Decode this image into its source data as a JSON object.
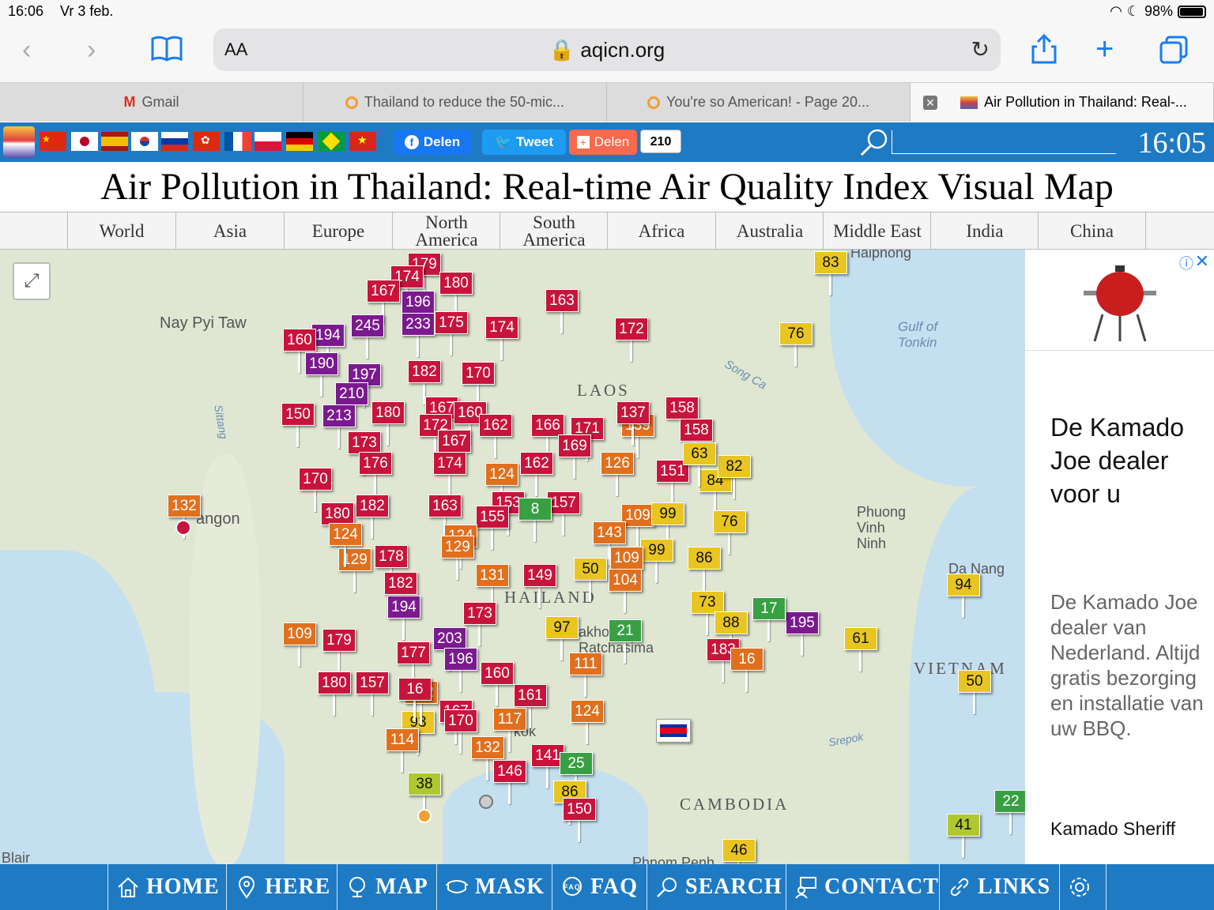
{
  "status": {
    "time": "16:06",
    "date": "Vr 3 feb.",
    "battery": "98%"
  },
  "toolbar": {
    "aa": "AA",
    "url": "aqicn.org"
  },
  "tabs": [
    {
      "label": "Gmail"
    },
    {
      "label": "Thailand to reduce the 50-mic..."
    },
    {
      "label": "You're so American! - Page 20..."
    },
    {
      "label": "Air Pollution in Thailand: Real-..."
    }
  ],
  "share": {
    "facebook": "Delen",
    "twitter": "Tweet",
    "addthis": "Delen",
    "count": "210"
  },
  "clock": "16:05",
  "title": "Air Pollution in Thailand: Real-time Air Quality Index Visual Map",
  "regions": [
    "World",
    "Asia",
    "Europe",
    "North America",
    "South America",
    "Africa",
    "Australia",
    "Middle East",
    "India",
    "China"
  ],
  "map_labels": {
    "naypyitaw": "Nay Pyi Taw",
    "rangoon": "angon",
    "laos": "LAOS",
    "thailand": "HAILAND",
    "cambodia": "CAMBODIA",
    "vietnam": "VIETNAM",
    "gulf": "Gulf of Tonkin",
    "phuong": "Phuong Vinh Ninh",
    "danang": "Da Nang",
    "haiphong": "Haiphong",
    "blair": "Blair",
    "phnom": "Phnom Penh",
    "songca": "Song Ca",
    "sittang": "Sittang",
    "srepok": "Srepok",
    "nakhon": "akhon Ratchasima",
    "bangkok": "kok"
  },
  "markers": [
    {
      "v": "179",
      "c": "#c8143c"
    },
    {
      "v": "174",
      "c": "#c8143c"
    },
    {
      "v": "180",
      "c": "#c8143c"
    },
    {
      "v": "167",
      "c": "#c8143c"
    },
    {
      "v": "196",
      "c": "#7b1a8f"
    },
    {
      "v": "163",
      "c": "#c8143c"
    },
    {
      "v": "245",
      "c": "#7b1a8f"
    },
    {
      "v": "233",
      "c": "#7b1a8f"
    },
    {
      "v": "175",
      "c": "#c8143c"
    },
    {
      "v": "174",
      "c": "#c8143c"
    },
    {
      "v": "172",
      "c": "#c8143c"
    },
    {
      "v": "194",
      "c": "#7b1a8f"
    },
    {
      "v": "160",
      "c": "#c8143c"
    },
    {
      "v": "190",
      "c": "#7b1a8f"
    },
    {
      "v": "197",
      "c": "#7b1a8f"
    },
    {
      "v": "182",
      "c": "#c8143c"
    },
    {
      "v": "170",
      "c": "#c8143c"
    },
    {
      "v": "210",
      "c": "#7b1a8f"
    },
    {
      "v": "180",
      "c": "#c8143c"
    },
    {
      "v": "213",
      "c": "#7b1a8f"
    },
    {
      "v": "167",
      "c": "#c8143c"
    },
    {
      "v": "160",
      "c": "#c8143c"
    },
    {
      "v": "172",
      "c": "#c8143c"
    },
    {
      "v": "162",
      "c": "#c8143c"
    },
    {
      "v": "166",
      "c": "#c8143c"
    },
    {
      "v": "171",
      "c": "#c8143c"
    },
    {
      "v": "158",
      "c": "#c8143c"
    },
    {
      "v": "139",
      "c": "#e0701e"
    },
    {
      "v": "158",
      "c": "#c8143c"
    },
    {
      "v": "173",
      "c": "#c8143c"
    },
    {
      "v": "167",
      "c": "#c8143c"
    },
    {
      "v": "169",
      "c": "#c8143c"
    },
    {
      "v": "176",
      "c": "#c8143c"
    },
    {
      "v": "174",
      "c": "#c8143c"
    },
    {
      "v": "124",
      "c": "#e0701e"
    },
    {
      "v": "162",
      "c": "#c8143c"
    },
    {
      "v": "126",
      "c": "#e0701e"
    },
    {
      "v": "151",
      "c": "#c8143c"
    },
    {
      "v": "84",
      "c": "#e8c520"
    },
    {
      "v": "82",
      "c": "#e8c520"
    },
    {
      "v": "170",
      "c": "#c8143c"
    },
    {
      "v": "132",
      "c": "#e0701e"
    },
    {
      "v": "182",
      "c": "#c8143c"
    },
    {
      "v": "163",
      "c": "#c8143c"
    },
    {
      "v": "153",
      "c": "#c8143c"
    },
    {
      "v": "157",
      "c": "#c8143c"
    },
    {
      "v": "8",
      "c": "#38a043"
    },
    {
      "v": "180",
      "c": "#c8143c"
    },
    {
      "v": "155",
      "c": "#c8143c"
    },
    {
      "v": "109",
      "c": "#e0701e"
    },
    {
      "v": "99",
      "c": "#e8c520"
    },
    {
      "v": "76",
      "c": "#e8c520"
    },
    {
      "v": "124",
      "c": "#e0701e"
    },
    {
      "v": "143",
      "c": "#e0701e"
    },
    {
      "v": "129",
      "c": "#e0701e"
    },
    {
      "v": "178",
      "c": "#c8143c"
    },
    {
      "v": "99",
      "c": "#e8c520"
    },
    {
      "v": "109",
      "c": "#e0701e"
    },
    {
      "v": "86",
      "c": "#e8c520"
    },
    {
      "v": "129",
      "c": "#e0701e"
    },
    {
      "v": "131",
      "c": "#e0701e"
    },
    {
      "v": "149",
      "c": "#c8143c"
    },
    {
      "v": "50",
      "c": "#e8c520"
    },
    {
      "v": "104",
      "c": "#e0701e"
    },
    {
      "v": "182",
      "c": "#c8143c"
    },
    {
      "v": "194",
      "c": "#7b1a8f"
    },
    {
      "v": "173",
      "c": "#c8143c"
    },
    {
      "v": "179",
      "c": "#c8143c"
    },
    {
      "v": "203",
      "c": "#7b1a8f"
    },
    {
      "v": "97",
      "c": "#e8c520"
    },
    {
      "v": "21",
      "c": "#38a043"
    },
    {
      "v": "73",
      "c": "#e8c520"
    },
    {
      "v": "88",
      "c": "#e8c520"
    },
    {
      "v": "195",
      "c": "#7b1a8f"
    },
    {
      "v": "177",
      "c": "#c8143c"
    },
    {
      "v": "196",
      "c": "#7b1a8f"
    },
    {
      "v": "111",
      "c": "#e0701e"
    },
    {
      "v": "183",
      "c": "#c8143c"
    },
    {
      "v": "160",
      "c": "#c8143c"
    },
    {
      "v": "157",
      "c": "#c8143c"
    },
    {
      "v": "161",
      "c": "#c8143c"
    },
    {
      "v": "167",
      "c": "#c8143c"
    },
    {
      "v": "117",
      "c": "#e0701e"
    },
    {
      "v": "124",
      "c": "#e0701e"
    },
    {
      "v": "93",
      "c": "#e8c520"
    },
    {
      "v": "114",
      "c": "#e0701e"
    },
    {
      "v": "132",
      "c": "#e0701e"
    },
    {
      "v": "141",
      "c": "#c8143c"
    },
    {
      "v": "25",
      "c": "#38a043"
    },
    {
      "v": "146",
      "c": "#c8143c"
    },
    {
      "v": "38",
      "c": "#b0c830"
    },
    {
      "v": "86",
      "c": "#e8c520"
    },
    {
      "v": "150",
      "c": "#c8143c"
    },
    {
      "v": "76",
      "c": "#e8c520"
    },
    {
      "v": "83",
      "c": "#e8c520"
    },
    {
      "v": "94",
      "c": "#e8c520"
    },
    {
      "v": "61",
      "c": "#e8c520"
    },
    {
      "v": "50",
      "c": "#e8c520"
    },
    {
      "v": "22",
      "c": "#38a043"
    },
    {
      "v": "41",
      "c": "#b0c830"
    },
    {
      "v": "46",
      "c": "#e8c520"
    },
    {
      "v": "132",
      "c": "#e0701e"
    },
    {
      "v": "180",
      "c": "#c8143c"
    },
    {
      "v": "124",
      "c": "#e0701e"
    },
    {
      "v": "16",
      "c": "#c8143c"
    },
    {
      "v": "109",
      "c": "#e0701e"
    },
    {
      "v": "150",
      "c": "#c8143c"
    },
    {
      "v": "170",
      "c": "#c8143c"
    },
    {
      "v": "17",
      "c": "#38a043"
    },
    {
      "v": "63",
      "c": "#e8c520"
    },
    {
      "v": "16",
      "c": "#e0701e"
    },
    {
      "v": "137",
      "c": "#c8143c"
    }
  ],
  "ad": {
    "headline": "De Kamado Joe dealer voor u",
    "body": "De Kamado Joe dealer van Nederland. Altijd gratis bezorging en installatie van uw BBQ.",
    "brand": "Kamado Sheriff"
  },
  "bottomnav": [
    "HOME",
    "HERE",
    "MAP",
    "MASK",
    "FAQ",
    "SEARCH",
    "CONTACT",
    "LINKS"
  ]
}
